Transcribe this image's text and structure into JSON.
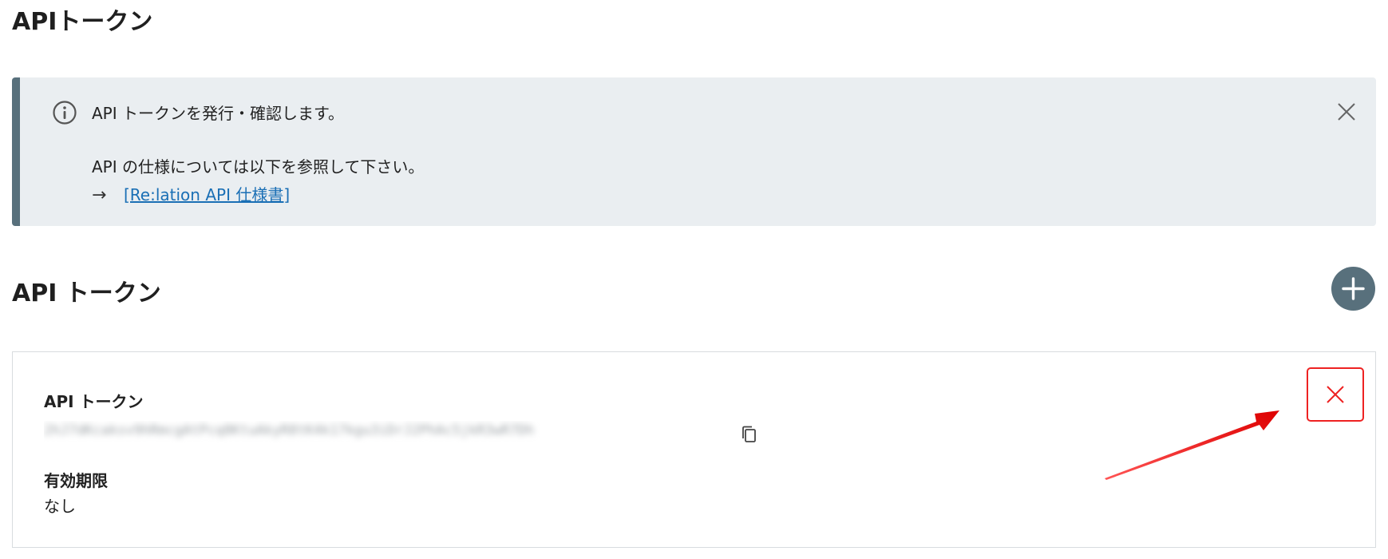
{
  "page": {
    "title": "APIトークン"
  },
  "info_box": {
    "line1": "API トークンを発行・確認します。",
    "line2": "API の仕様については以下を参照して下さい。",
    "arrow": "→",
    "link_text": "[Re:lation API 仕様書]",
    "icons": {
      "info": "info-circle-icon",
      "close": "close-icon"
    }
  },
  "tokens_section": {
    "title": "API トークン",
    "add_icon": "plus-icon"
  },
  "token_card": {
    "token_label": "API トークン",
    "token_value": "2hJ7dKcaksv9hRmcgAtPcq8KtuAkyR8tK4k17kgu3iDrJ2PhAc5jkR3wR7Dh",
    "copy_icon": "copy-icon",
    "expiry_label": "有効期限",
    "expiry_value": "なし",
    "delete_icon": "close-icon"
  },
  "annotation": {
    "color": "#ee1111",
    "highlight_color": "#ee2222"
  },
  "colors": {
    "accent": "#58707c",
    "info_bg": "#eaeef1",
    "link": "#1a6fb5"
  }
}
